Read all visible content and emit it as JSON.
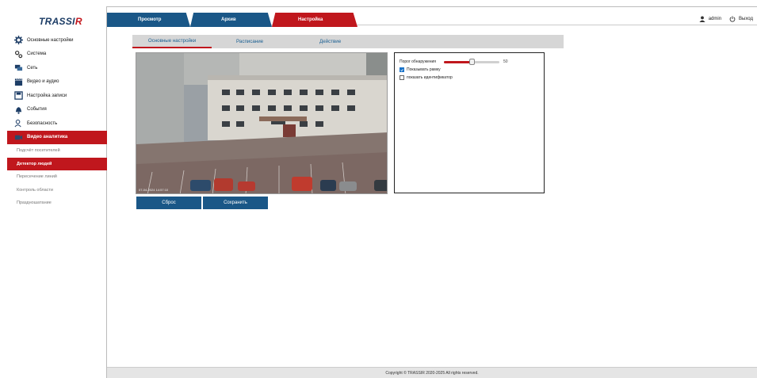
{
  "logo": {
    "text_a": "TRASSI",
    "text_b": "R"
  },
  "sidebar": {
    "items": [
      {
        "label": "Основные настройки",
        "icon": "gear-icon"
      },
      {
        "label": "Система",
        "icon": "gears-icon"
      },
      {
        "label": "Сеть",
        "icon": "network-icon"
      },
      {
        "label": "Видео и аудио",
        "icon": "clapper-icon"
      },
      {
        "label": "Настройка записи",
        "icon": "disk-icon"
      },
      {
        "label": "События",
        "icon": "bell-icon"
      },
      {
        "label": "Безопасность",
        "icon": "user-lock-icon"
      },
      {
        "label": "Видео аналитика",
        "icon": "analytics-icon"
      }
    ],
    "subitems": [
      {
        "label": "Подсчёт посетителей"
      },
      {
        "label": "Детектор людей"
      },
      {
        "label": "Пересечение линий"
      },
      {
        "label": "Контроль области"
      },
      {
        "label": "Праздношатание"
      }
    ]
  },
  "tabs": {
    "view": "Просмотр",
    "archive": "Архив",
    "settings": "Настройка"
  },
  "user": {
    "name": "admin",
    "logout": "Выход"
  },
  "subtabs": {
    "basic": "Основные настройки",
    "schedule": "Расписание",
    "action": "Действие"
  },
  "video": {
    "timestamp": "07-04-2024 14:57:10"
  },
  "settings": {
    "threshold_label": "Порог обнаружения",
    "threshold_value": "50",
    "threshold_fraction": 0.5,
    "show_frame_label": "Показывать рамку",
    "show_frame_checked": true,
    "show_id_label": "показать идентификатор",
    "show_id_checked": false
  },
  "buttons": {
    "reset": "Сброс",
    "save": "Сохранить"
  },
  "footer": {
    "copyright": "Copyright © TRASSIR 2020-2025 All rights reserved."
  },
  "colors": {
    "accent_red": "#c0171d",
    "accent_blue": "#1a5787"
  }
}
